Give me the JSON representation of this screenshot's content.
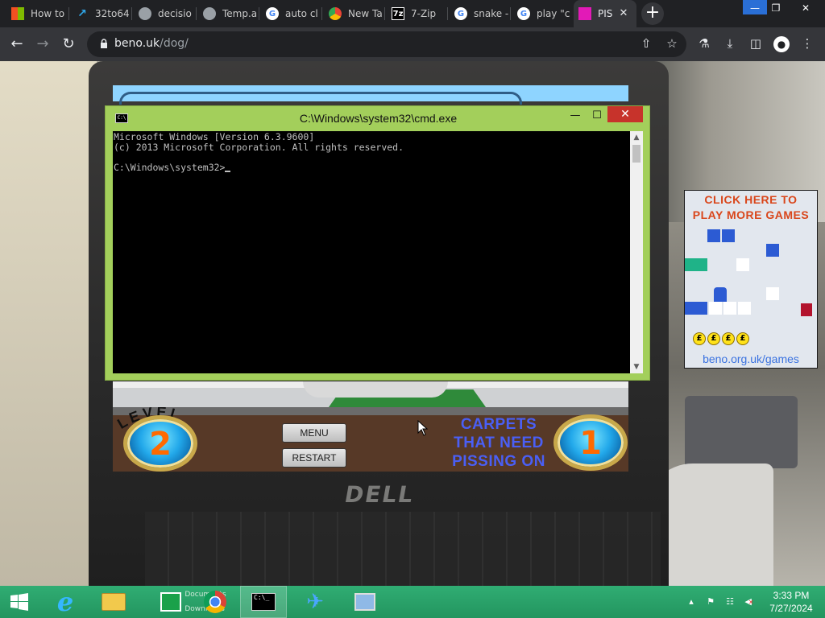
{
  "browser": {
    "tabs": [
      {
        "title": "How to",
        "icon": "microsoft-icon"
      },
      {
        "title": "32to64",
        "icon": "edge-icon"
      },
      {
        "title": "decisio",
        "icon": "globe-icon"
      },
      {
        "title": "Temp.a",
        "icon": "globe-icon"
      },
      {
        "title": "auto cl",
        "icon": "google-icon"
      },
      {
        "title": "New Ta",
        "icon": "chrome-icon"
      },
      {
        "title": "7-Zip",
        "icon": "7zip-icon"
      },
      {
        "title": "snake -",
        "icon": "google-icon"
      },
      {
        "title": "play \"c",
        "icon": "google-icon"
      },
      {
        "title": "PIS",
        "icon": "game-icon",
        "active": true
      }
    ],
    "url_host": "beno.uk",
    "url_path": "/dog/"
  },
  "cmd": {
    "title": "C:\\Windows\\system32\\cmd.exe",
    "lines": [
      "Microsoft Windows [Version 6.3.9600]",
      "(c) 2013 Microsoft Corporation. All rights reserved.",
      "",
      "C:\\Windows\\system32>"
    ]
  },
  "game": {
    "level_label": "LEVEL",
    "level": "2",
    "menu_label": "MENU",
    "restart_label": "RESTART",
    "carpets_label": [
      "CARPETS",
      "THAT NEED",
      "PISSING ON"
    ],
    "carpets_count": "1"
  },
  "ad": {
    "title_line1": "CLICK HERE TO",
    "title_line2": "PLAY MORE GAMES",
    "coins": [
      "£",
      "£",
      "£",
      "£"
    ],
    "url": "beno.org.uk/games"
  },
  "laptop_brand": "DELL",
  "taskbar": {
    "folder_labels": [
      "Documents",
      "Downloads"
    ],
    "time": "3:33 PM",
    "date": "7/27/2024"
  }
}
